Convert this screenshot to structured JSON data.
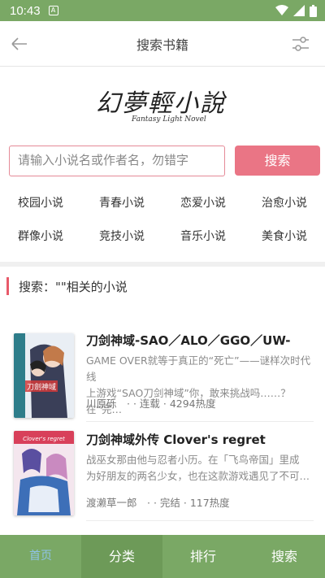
{
  "status": {
    "time": "10:43",
    "notif_icon": "A"
  },
  "header": {
    "title": "搜索书籍"
  },
  "logo": {
    "text": "幻夢輕小說",
    "subtitle": "Fantasy Light Novel"
  },
  "search": {
    "placeholder": "请输入小说名或作者名，勿错字",
    "button_label": "搜索"
  },
  "categories": [
    "校园小说",
    "青春小说",
    "恋爱小说",
    "治愈小说",
    "群像小说",
    "竞技小说",
    "音乐小说",
    "美食小说"
  ],
  "results": {
    "heading": "搜索：\"\"相关的小说",
    "books": [
      {
        "title": "刀剑神域-SAO／ALO／GGO／UW-",
        "desc_line1": "GAME OVER就等于真正的“死亡”——谜样次时代线",
        "desc_line2": "上游戏“SAO刀剑神域”你，敢来挑战吗……？在“完…",
        "meta": "川原砾　·  · 连载 · 4294热度",
        "cover_label": "刀劍神域"
      },
      {
        "title": "刀剑神域外传 Clover's regret",
        "desc_line1": "战巫女那由他与忍者小历。在「飞鸟帝国」里成",
        "desc_line2": "为好朋友的两名少女，也在这款游戏遇见了不可…",
        "meta": "渡濑草一郎　·  · 完结 · 117热度",
        "cover_label": "Clover's regret"
      }
    ]
  },
  "tabs": [
    "首页",
    "分类",
    "排行",
    "搜索"
  ],
  "colors": {
    "green": "#7aa865",
    "pink": "#ea7585",
    "accent": "#e85a6a"
  }
}
